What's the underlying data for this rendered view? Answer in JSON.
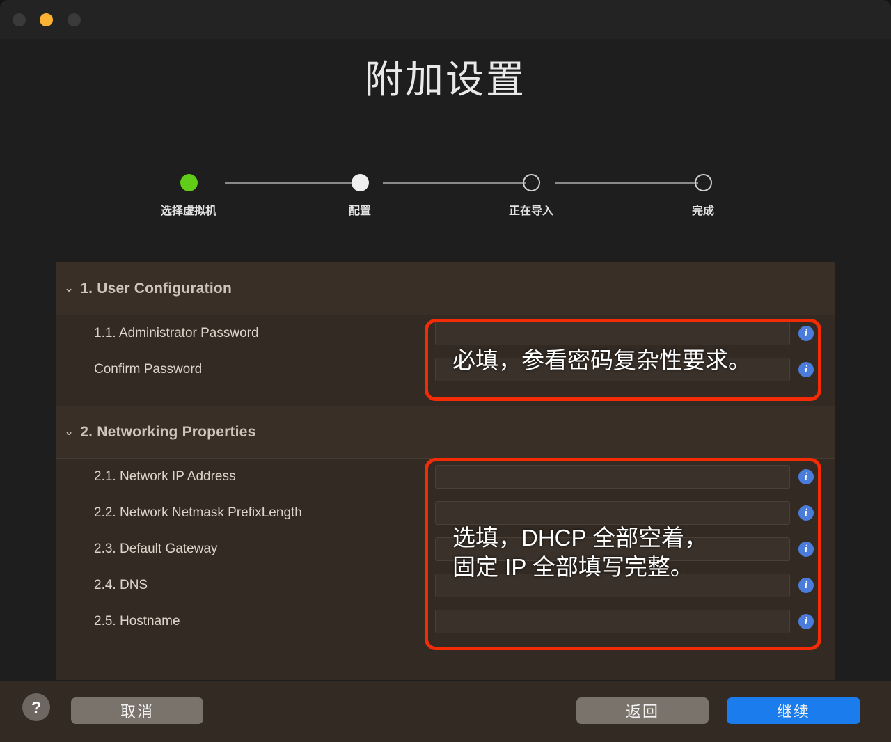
{
  "window": {
    "traffic_lights": [
      "close",
      "minimize",
      "zoom"
    ]
  },
  "header": {
    "title": "附加设置"
  },
  "stepper": {
    "steps": [
      {
        "label": "选择虚拟机",
        "state": "done"
      },
      {
        "label": "配置",
        "state": "current"
      },
      {
        "label": "正在导入",
        "state": "todo"
      },
      {
        "label": "完成",
        "state": "todo"
      }
    ],
    "colors": {
      "done": "#61cd18",
      "current": "#efefef",
      "todo_border": "#cfcfcf"
    }
  },
  "sections": [
    {
      "chevron": "⌄",
      "title": "1. User Configuration",
      "rows": [
        {
          "label": "1.1. Administrator Password",
          "value": "",
          "info": "i"
        },
        {
          "label": "Confirm Password",
          "value": "",
          "info": "i"
        }
      ]
    },
    {
      "chevron": "⌄",
      "title": "2. Networking Properties",
      "rows": [
        {
          "label": "2.1. Network IP Address",
          "value": "",
          "info": "i"
        },
        {
          "label": "2.2. Network Netmask PrefixLength",
          "value": "",
          "info": "i"
        },
        {
          "label": "2.3. Default Gateway",
          "value": "",
          "info": "i"
        },
        {
          "label": "2.4. DNS",
          "value": "",
          "info": "i"
        },
        {
          "label": "2.5. Hostname",
          "value": "",
          "info": "i"
        }
      ]
    }
  ],
  "annotations": {
    "color": "#f42c06",
    "items": [
      {
        "text": "必填，参看密码复杂性要求。"
      },
      {
        "text": "选填，DHCP 全部空着，\n固定 IP 全部填写完整。"
      }
    ]
  },
  "footer": {
    "help_label": "?",
    "cancel_label": "取消",
    "back_label": "返回",
    "continue_label": "继续",
    "continue_color": "#1a7ced"
  }
}
